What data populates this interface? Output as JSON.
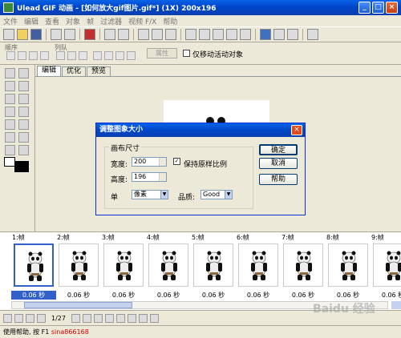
{
  "window": {
    "title": "Ulead GIF 动画 - [如何放大gif图片.gif*] (1X) 200x196",
    "minimize": "_",
    "maximize": "□",
    "close": "×"
  },
  "menu": [
    "文件",
    "编辑",
    "查看",
    "对象",
    "帧",
    "过滤器",
    "视频 F/X",
    "帮助"
  ],
  "toolbar2": {
    "order_label": "顺序",
    "queue_label": "列队",
    "attributes_button": "属性",
    "move_only_active_label": "仅移动活动对象"
  },
  "tabs": [
    "编辑",
    "优化",
    "预览"
  ],
  "dialog": {
    "title": "调整图象大小",
    "close": "×",
    "group_title": "画布尺寸",
    "width_label": "宽度:",
    "width_value": "200",
    "height_label": "高度:",
    "height_value": "196",
    "unit_label": "单",
    "unit_value": "像素",
    "quality_label": "品质:",
    "quality_value": "Good",
    "keep_ratio_label": "保持原样比例",
    "ok_button": "确定",
    "cancel_button": "取消",
    "help_button": "帮助"
  },
  "frames": [
    {
      "label": "1:帧",
      "time": "0.06 秒"
    },
    {
      "label": "2:帧",
      "time": "0.06 秒"
    },
    {
      "label": "3:帧",
      "time": "0.06 秒"
    },
    {
      "label": "4:帧",
      "time": "0.06 秒"
    },
    {
      "label": "5:帧",
      "time": "0.06 秒"
    },
    {
      "label": "6:帧",
      "time": "0.06 秒"
    },
    {
      "label": "7:帧",
      "time": "0.06 秒"
    },
    {
      "label": "8:帧",
      "time": "0.06 秒"
    },
    {
      "label": "9:帧",
      "time": "0.06 秒"
    }
  ],
  "playbar": {
    "frame_counter": "1/27"
  },
  "status": {
    "text": "使用帮助, 按 F1",
    "overlay": "sina866168"
  },
  "watermark": "Baidu 经验"
}
